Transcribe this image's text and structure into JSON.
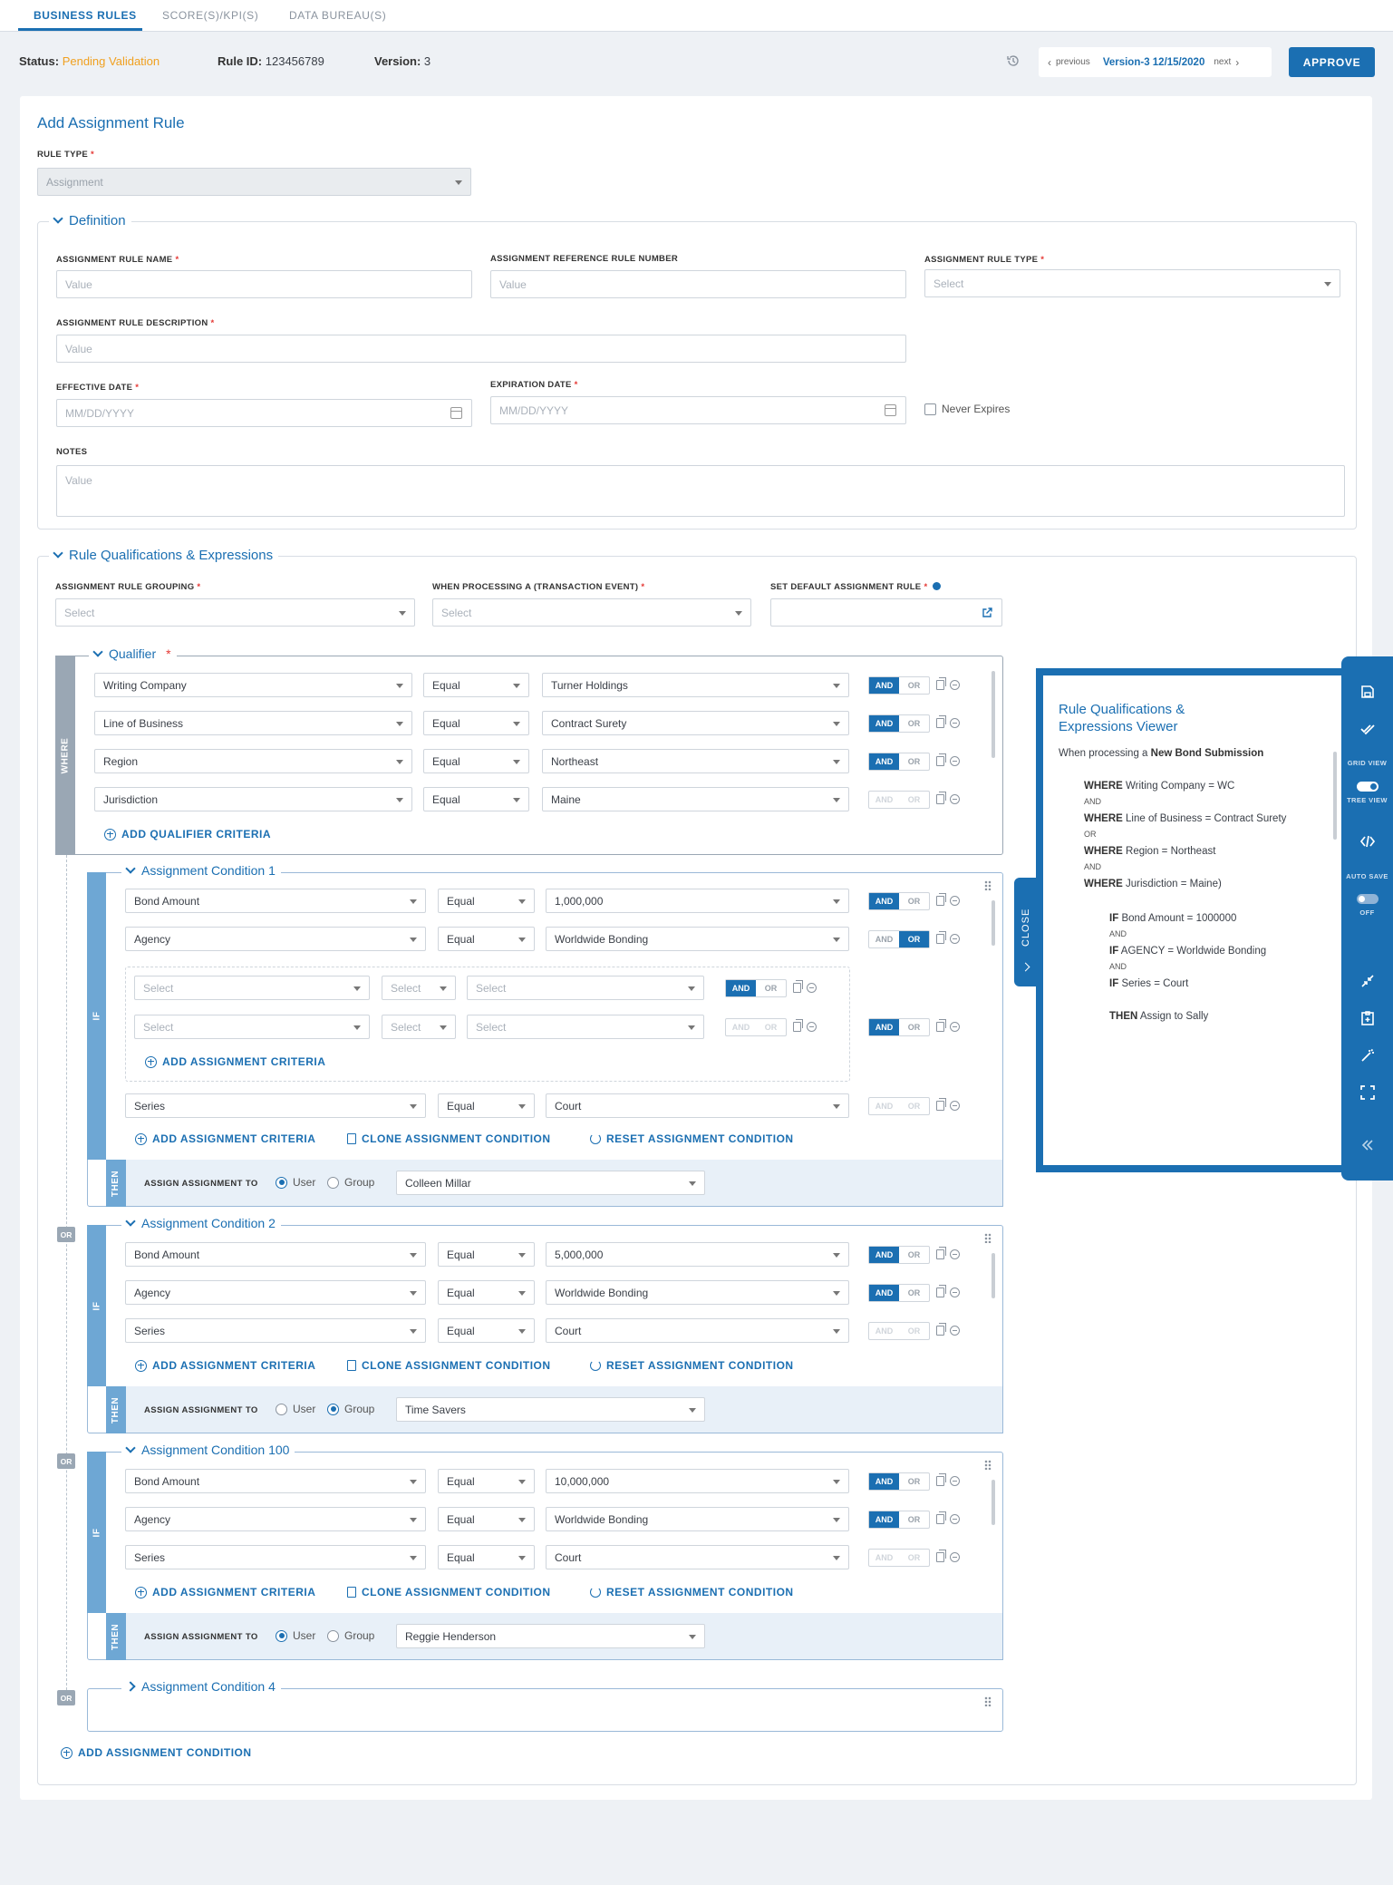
{
  "tabs": [
    "BUSINESS RULES",
    "SCORE(S)/KPI(S)",
    "DATA BUREAU(S)"
  ],
  "status": {
    "status_label": "Status:",
    "status_value": "Pending Validation",
    "rule_id_label": "Rule ID:",
    "rule_id": "123456789",
    "version_label": "Version:",
    "version": "3"
  },
  "version_nav": {
    "previous": "previous",
    "current": "Version-3 12/15/2020",
    "next": "next"
  },
  "approve": "APPROVE",
  "page_title": "Add Assignment Rule",
  "rule_type": {
    "label": "RULE TYPE",
    "value": "Assignment"
  },
  "definition": {
    "title": "Definition",
    "name_label": "ASSIGNMENT RULE NAME",
    "ref_label": "ASSIGNMENT REFERENCE RULE NUMBER",
    "type_label": "ASSIGNMENT RULE TYPE",
    "desc_label": "ASSIGNMENT RULE DESCRIPTION",
    "eff_label": "EFFECTIVE DATE",
    "exp_label": "EXPIRATION DATE",
    "never_expires": "Never Expires",
    "notes_label": "NOTES",
    "value_ph": "Value",
    "select_ph": "Select",
    "date_ph": "MM/DD/YYYY"
  },
  "rq": {
    "title": "Rule Qualifications & Expressions",
    "grouping_label": "ASSIGNMENT RULE GROUPING",
    "event_label": "WHEN PROCESSING A (TRANSACTION EVENT)",
    "default_label": "SET DEFAULT ASSIGNMENT RULE",
    "select_ph": "Select"
  },
  "qualifier": {
    "title": "Qualifier",
    "where": "WHERE",
    "rows": [
      {
        "field": "Writing Company",
        "op": "Equal",
        "value": "Turner Holdings"
      },
      {
        "field": "Line of Business",
        "op": "Equal",
        "value": "Contract Surety"
      },
      {
        "field": "Region",
        "op": "Equal",
        "value": "Northeast"
      },
      {
        "field": "Jurisdiction",
        "op": "Equal",
        "value": "Maine"
      }
    ],
    "add": "ADD QUALIFIER CRITERIA"
  },
  "labels": {
    "and": "AND",
    "or": "OR",
    "if": "IF",
    "then": "THEN",
    "assign_to": "ASSIGN ASSIGNMENT TO",
    "user": "User",
    "group": "Group",
    "add_criteria": "ADD ASSIGNMENT CRITERIA",
    "clone": "CLONE ASSIGNMENT CONDITION",
    "reset": "RESET ASSIGNMENT CONDITION",
    "select": "Select"
  },
  "conditions": [
    {
      "title": "Assignment Condition 1",
      "rows": [
        {
          "field": "Bond Amount",
          "op": "Equal",
          "value": "1,000,000"
        },
        {
          "field": "Agency",
          "op": "Equal",
          "value": "Worldwide Bonding"
        },
        {
          "field": "Series",
          "op": "Equal",
          "value": "Court"
        }
      ],
      "assignee": "Colleen Millar"
    },
    {
      "title": "Assignment Condition 2",
      "rows": [
        {
          "field": "Bond Amount",
          "op": "Equal",
          "value": "5,000,000"
        },
        {
          "field": "Agency",
          "op": "Equal",
          "value": "Worldwide Bonding"
        },
        {
          "field": "Series",
          "op": "Equal",
          "value": "Court"
        }
      ],
      "assignee": "Time Savers"
    },
    {
      "title": "Assignment Condition 100",
      "rows": [
        {
          "field": "Bond Amount",
          "op": "Equal",
          "value": "10,000,000"
        },
        {
          "field": "Agency",
          "op": "Equal",
          "value": "Worldwide Bonding"
        },
        {
          "field": "Series",
          "op": "Equal",
          "value": "Court"
        }
      ],
      "assignee": "Reggie Henderson"
    },
    {
      "title": "Assignment Condition 4"
    }
  ],
  "add_condition": "ADD ASSIGNMENT CONDITION",
  "viewer": {
    "title1": "Rule Qualifications &",
    "title2": "Expressions Viewer",
    "intro": "When processing a",
    "event": "New Bond Submission",
    "where": "WHERE",
    "if": "IF",
    "then": "THEN",
    "and": "AND",
    "or": "OR",
    "w1": "Writing Company = WC",
    "w2": "Line of Business = Contract Surety",
    "w3": "Region = Northeast",
    "w4": "Jurisdiction = Maine)",
    "i1": "Bond Amount = 1000000",
    "i2": "AGENCY = Worldwide Bonding",
    "i3": "Series = Court",
    "t1": "Assign to Sally",
    "close": "CLOSE"
  },
  "rail": {
    "grid_view": "GRID VIEW",
    "tree_view": "TREE VIEW",
    "auto_save": "AUTO SAVE",
    "off": "OFF"
  },
  "colors": {
    "accent": "#1b6fb2",
    "status": "#f0a020",
    "where_bar": "#9aa7b4",
    "if_bar": "#6ea7d4"
  }
}
